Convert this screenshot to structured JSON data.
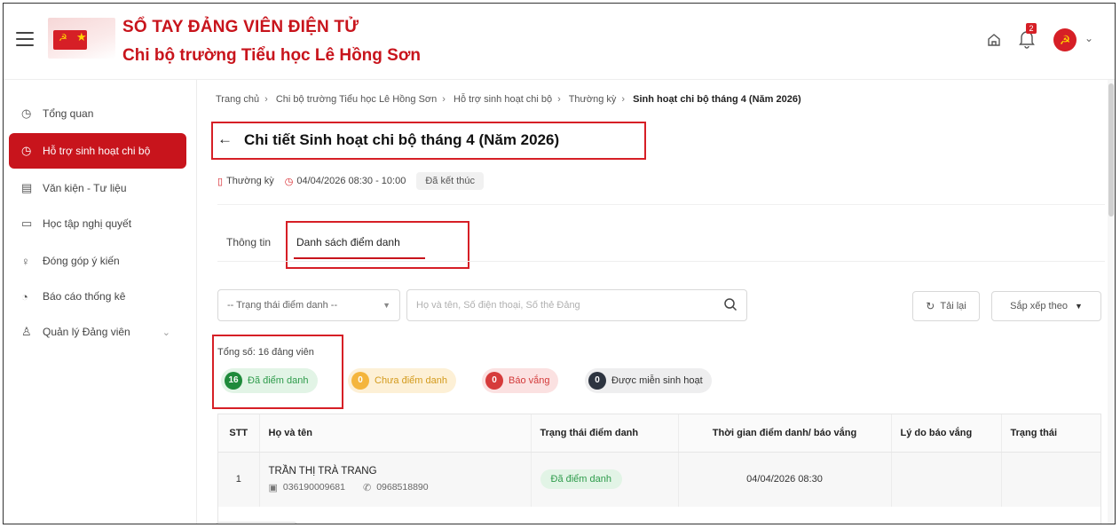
{
  "header": {
    "title": "SỔ TAY ĐẢNG VIÊN ĐIỆN TỬ",
    "subtitle": "Chi bộ trường Tiểu học Lê Hồng Sơn",
    "notification_count": "2"
  },
  "sidebar": {
    "items": [
      {
        "label": "Tổng quan",
        "icon": "clock-icon"
      },
      {
        "label": "Hỗ trợ sinh hoạt chi bộ",
        "icon": "clock-icon"
      },
      {
        "label": "Văn kiện - Tư liệu",
        "icon": "document-icon"
      },
      {
        "label": "Học tập nghị quyết",
        "icon": "book-icon"
      },
      {
        "label": "Đóng góp ý kiến",
        "icon": "lightbulb-icon"
      },
      {
        "label": "Báo cáo thống kê",
        "icon": "chart-icon"
      },
      {
        "label": "Quản lý Đảng viên",
        "icon": "user-icon"
      }
    ]
  },
  "breadcrumb": {
    "items": [
      "Trang chủ",
      "Chi bộ trường Tiểu học Lê Hồng Sơn",
      "Hỗ trợ sinh hoạt chi bộ",
      "Thường kỳ"
    ],
    "current": "Sinh hoạt chi bộ tháng 4 (Năm 2026)"
  },
  "page": {
    "title": "Chi tiết Sinh hoạt chi bộ tháng 4 (Năm 2026)",
    "type": "Thường kỳ",
    "datetime": "04/04/2026 08:30 - 10:00",
    "status": "Đã kết thúc"
  },
  "tabs": {
    "info": "Thông tin",
    "attendance": "Danh sách điểm danh"
  },
  "filters": {
    "status_select": "-- Trạng thái điểm danh --",
    "search_placeholder": "Họ và tên, Số điện thoại, Số thẻ Đảng",
    "reload": "Tải lại",
    "sort": "Sắp xếp theo"
  },
  "summary": {
    "total": "Tổng số: 16 đảng viên",
    "chips": [
      {
        "count": "16",
        "label": "Đã điểm danh",
        "color": "#1f8a3b"
      },
      {
        "count": "0",
        "label": "Chưa điểm danh",
        "color": "#f4b53d"
      },
      {
        "count": "0",
        "label": "Báo vắng",
        "color": "#d63b3b"
      },
      {
        "count": "0",
        "label": "Được miễn sinh hoạt",
        "color": "#2d3440"
      }
    ]
  },
  "table": {
    "columns": [
      "STT",
      "Họ và tên",
      "Trạng thái điểm danh",
      "Thời gian điểm danh/ báo vắng",
      "Lý do báo vắng",
      "Trạng thái"
    ],
    "rows": [
      {
        "stt": "1",
        "name": "TRẦN THỊ TRÀ TRANG",
        "card_no": "036190009681",
        "phone": "0968518890",
        "attendance": "Đã điểm danh",
        "time": "04/04/2026 08:30",
        "reason": "",
        "state": ""
      }
    ]
  },
  "colors": {
    "brand_red": "#c8141c",
    "highlight_border": "#d61f26",
    "success": "#1f8a3b"
  }
}
